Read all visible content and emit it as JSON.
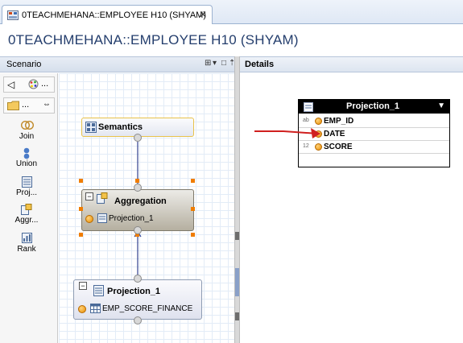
{
  "tab": {
    "title": "0TEACHMEHANA::EMPLOYEE H10 (SHYAM)",
    "close_glyph": "✕"
  },
  "page": {
    "title": "0TEACHMEHANA::EMPLOYEE H10 (SHYAM)"
  },
  "scenario": {
    "title": "Scenario",
    "controls": [
      "⊞",
      "▾",
      "□",
      "⇡"
    ],
    "toolbar": {
      "back_glyph": "◁",
      "more_label": "...",
      "folder_more_label": "...",
      "collapse_glyph": "⇔"
    },
    "palette": [
      {
        "label": "Join",
        "icon": "join-icon"
      },
      {
        "label": "Union",
        "icon": "union-icon"
      },
      {
        "label": "Proj...",
        "icon": "projection-icon"
      },
      {
        "label": "Aggr...",
        "icon": "aggregation-icon"
      },
      {
        "label": "Rank",
        "icon": "rank-icon"
      }
    ]
  },
  "canvas": {
    "semantics": {
      "title": "Semantics"
    },
    "aggregation": {
      "title": "Aggregation",
      "input": "Projection_1"
    },
    "projection": {
      "title": "Projection_1",
      "source": "EMP_SCORE_FINANCE"
    }
  },
  "details": {
    "title": "Details",
    "popup": {
      "title": "Projection_1",
      "columns": [
        {
          "name": "EMP_ID",
          "type": "ab"
        },
        {
          "name": "DATE",
          "type": ""
        },
        {
          "name": "SCORE",
          "type": "12"
        }
      ]
    }
  },
  "colors": {
    "title_blue": "#243e6d",
    "selection_orange": "#f07d00",
    "annotation_red": "#d0201f",
    "connector_blue": "#31418f"
  }
}
